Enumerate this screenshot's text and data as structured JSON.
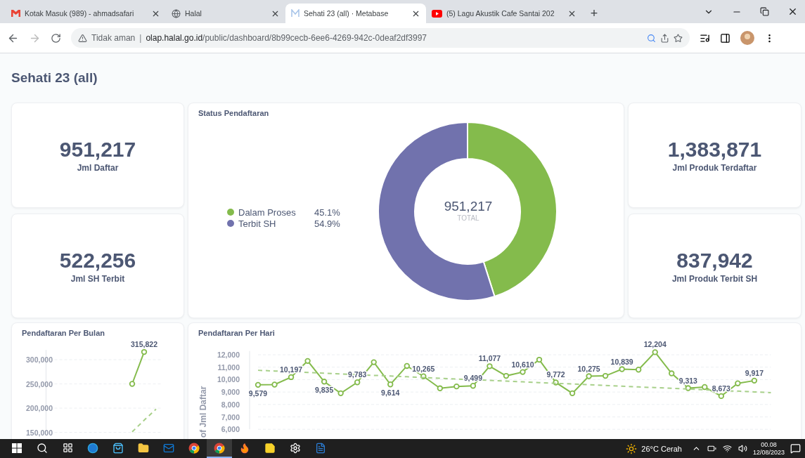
{
  "browser": {
    "tabs": [
      {
        "title": "Kotak Masuk (989) - ahmadsafari",
        "kind": "mail",
        "selected": false
      },
      {
        "title": "Halal",
        "kind": "globe",
        "selected": false
      },
      {
        "title": "Sehati 23 (all) · Metabase",
        "kind": "metabase",
        "selected": true
      },
      {
        "title": "(5) Lagu Akustik Cafe Santai 202",
        "kind": "video",
        "selected": false
      }
    ],
    "new_tab": "+",
    "security": "Tidak aman",
    "separator": "|",
    "url_host": "olap.halal.go.id",
    "url_path": "/public/dashboard/8b99cecb-6ee6-4269-942c-0deaf2df3997"
  },
  "dashboard": {
    "title": "Sehati 23 (all)",
    "scalars": [
      {
        "value": "951,217",
        "label": "Jml Daftar"
      },
      {
        "value": "1,383,871",
        "label": "Jml Produk Terdaftar"
      },
      {
        "value": "522,256",
        "label": "Jml SH Terbit"
      },
      {
        "value": "837,942",
        "label": "Jml Produk Terbit SH"
      }
    ],
    "status": {
      "legend": [
        {
          "percent": "45.1%",
          "color": "#84bb4c"
        },
        {
          "percent": "54.9%",
          "color": "#7172ad"
        }
      ],
      "total": "951,217",
      "total_label": "TOTAL",
      "chart_data": {
        "type": "donut",
        "title": "Status Pendaftaran",
        "categories": [
          "Dalam Proses",
          "Terbit SH"
        ],
        "values": [
          45.1,
          54.9
        ]
      }
    },
    "monthly": {
      "chart_data": {
        "type": "line",
        "title": "Pendaftaran Per Bulan",
        "grid": true,
        "categories": [
          null,
          null,
          null,
          null,
          null,
          null,
          null,
          null,
          null
        ],
        "ylim": [
          150000,
          320000
        ],
        "yticks": [
          {
            "value": 150000,
            "label": "150,000"
          },
          {
            "value": 200000,
            "label": "200,000"
          },
          {
            "value": 250000,
            "label": "250,000"
          },
          {
            "value": 300000,
            "label": "300,000"
          }
        ],
        "series": [
          {
            "color": "#84bb4c",
            "marker": "circle",
            "values": [
              null,
              null,
              null,
              null,
              null,
              null,
              250000,
              315822,
              null
            ]
          },
          {
            "color": "#a8d08a",
            "line_style": "dashed",
            "values": [
              null,
              null,
              null,
              null,
              null,
              null,
              151000,
              175000,
              198000
            ]
          }
        ],
        "value_labels": [
          null,
          null,
          null,
          null,
          null,
          null,
          null,
          "315,822",
          null
        ]
      }
    },
    "daily": {
      "chart_data": {
        "type": "line",
        "title": "Pendaftaran Per Hari",
        "ylabel": "of Jml Daftar",
        "grid": true,
        "categories": [
          null,
          null,
          null,
          null,
          null,
          null,
          null,
          null,
          null,
          null,
          null,
          null,
          null,
          null,
          null,
          null,
          null,
          null,
          null,
          null,
          null,
          null,
          null,
          null,
          null,
          null,
          null,
          null,
          null,
          null,
          null,
          null
        ],
        "ylim": [
          6000,
          12300
        ],
        "yticks": [
          {
            "value": 6000,
            "label": "6,000"
          },
          {
            "value": 7000,
            "label": "7,000"
          },
          {
            "value": 8000,
            "label": "8,000"
          },
          {
            "value": 9000,
            "label": "9,000"
          },
          {
            "value": 10000,
            "label": "10,000"
          },
          {
            "value": 11000,
            "label": "11,000"
          },
          {
            "value": 12000,
            "label": "12,000"
          }
        ],
        "series": [
          {
            "color": "#84bb4c",
            "marker": "circle",
            "values": [
              9579,
              9600,
              10197,
              11500,
              9835,
              8900,
              9783,
              11400,
              9614,
              11100,
              10265,
              9300,
              9450,
              9499,
              11077,
              10300,
              10610,
              11600,
              9772,
              8900,
              10275,
              10300,
              10839,
              10800,
              12204,
              10500,
              9313,
              9400,
              8673,
              9700,
              9917,
              null
            ]
          },
          {
            "color": "#a8d08a",
            "line_style": "dashed",
            "values": [
              10750,
              10690,
              10640,
              10580,
              10520,
              10460,
              10400,
              10340,
              10290,
              10230,
              10170,
              10110,
              10050,
              9990,
              9940,
              9880,
              9820,
              9760,
              9700,
              9650,
              9590,
              9530,
              9470,
              9410,
              9360,
              9300,
              9240,
              9180,
              9120,
              9070,
              9010,
              8950
            ]
          }
        ],
        "value_labels": [
          "9,579",
          null,
          "10,197",
          null,
          "9,835",
          null,
          "9,783",
          null,
          "9,614",
          null,
          "10,265",
          null,
          null,
          "9,499",
          "11,077",
          null,
          "10,610",
          null,
          "9,772",
          null,
          "10,275",
          null,
          "10,839",
          null,
          "12,204",
          null,
          "9,313",
          null,
          "8,673",
          null,
          "9,917",
          null
        ]
      }
    }
  },
  "taskbar": {
    "apps": [
      {
        "kind": "edge",
        "active": false
      },
      {
        "kind": "store",
        "active": false
      },
      {
        "kind": "folder",
        "active": false
      },
      {
        "kind": "mail",
        "active": false
      },
      {
        "kind": "chrome",
        "active": false
      },
      {
        "kind": "chrome",
        "active": true
      },
      {
        "kind": "firefox",
        "active": false
      },
      {
        "kind": "note",
        "active": false
      },
      {
        "kind": "gear",
        "active": false
      },
      {
        "kind": "word",
        "active": false
      }
    ],
    "weather": "26°C Cerah",
    "time": "00.08",
    "date": "12/08/2023"
  }
}
